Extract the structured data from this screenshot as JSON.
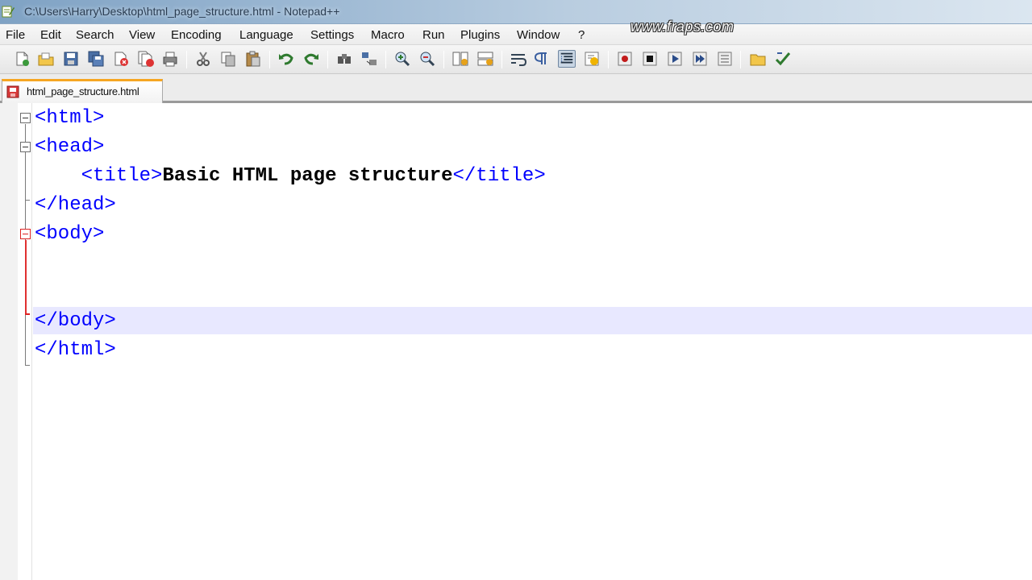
{
  "window": {
    "title": "C:\\Users\\Harry\\Desktop\\html_page_structure.html - Notepad++",
    "watermark": "www.fraps.com"
  },
  "menu": {
    "items": [
      "File",
      "Edit",
      "Search",
      "View",
      "Encoding",
      "Language",
      "Settings",
      "Macro",
      "Run",
      "Plugins",
      "Window",
      "?"
    ]
  },
  "toolbar": {
    "icons": [
      "new-file-icon",
      "open-file-icon",
      "save-icon",
      "save-all-icon",
      "close-icon",
      "close-all-icon",
      "print-icon",
      "cut-icon",
      "copy-icon",
      "paste-icon",
      "undo-icon",
      "redo-icon",
      "find-icon",
      "replace-icon",
      "zoom-in-icon",
      "zoom-out-icon",
      "sync-vertical-icon",
      "sync-horizontal-icon",
      "word-wrap-icon",
      "show-all-characters-icon",
      "indent-guide-icon",
      "user-language-icon",
      "record-macro-icon",
      "stop-macro-icon",
      "play-macro-icon",
      "run-macro-multiple-icon",
      "save-macro-icon",
      "folder-icon",
      "spell-check-icon"
    ]
  },
  "tabs": [
    {
      "label": "html_page_structure.html",
      "active": true
    }
  ],
  "editor": {
    "lines": [
      {
        "tag1": "<html>",
        "text": "",
        "tag2": ""
      },
      {
        "tag1": "<head>",
        "text": "",
        "tag2": ""
      },
      {
        "tag1": "    <title>",
        "text": "Basic HTML page structure",
        "tag2": "</title>"
      },
      {
        "tag1": "</head>",
        "text": "",
        "tag2": ""
      },
      {
        "tag1": "<body>",
        "text": "",
        "tag2": ""
      },
      {
        "tag1": "",
        "text": "",
        "tag2": ""
      },
      {
        "tag1": "",
        "text": "",
        "tag2": ""
      },
      {
        "tag1": "</body>",
        "text": "",
        "tag2": ""
      },
      {
        "tag1": "</html>",
        "text": "",
        "tag2": ""
      }
    ],
    "current_line": 8,
    "colors": {
      "tag": "#0000ff",
      "text": "#000000",
      "current_line_bg": "#e8e8ff",
      "fold_active": "#dd2222"
    }
  }
}
